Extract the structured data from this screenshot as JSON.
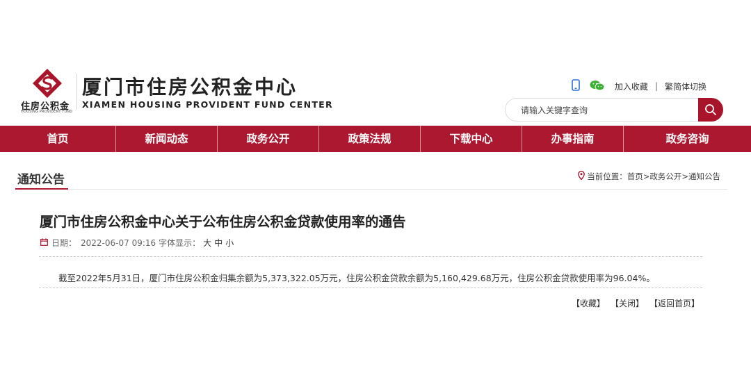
{
  "header": {
    "logo_cn": "住房公积金",
    "logo_en": "HOUSING PROVIDENT FUND",
    "site_title": "厦门市住房公积金中心",
    "site_subtitle": "XIAMEN HOUSING PROVIDENT FUND CENTER",
    "links": {
      "favorite": "加入收藏",
      "separator": "|",
      "lang_switch": "繁简体切换"
    },
    "icons": [
      "mobile-icon",
      "wechat-icon"
    ]
  },
  "search": {
    "placeholder": "请输入关键字查询",
    "icon": "search-icon"
  },
  "nav": {
    "items": [
      "首页",
      "新闻动态",
      "政务公开",
      "政策法规",
      "下载中心",
      "办事指南",
      "政务咨询"
    ]
  },
  "section": {
    "title": "通知公告",
    "breadcrumb_prefix": "当前位置：",
    "crumbs": [
      "首页",
      "政务公开",
      "通知公告"
    ],
    "crumb_sep": ">"
  },
  "article": {
    "title": "厦门市住房公积金中心关于公布住房公积金贷款使用率的通告",
    "date_label": "日期：",
    "date": "2022-06-07 09:16",
    "font_label": "字体显示：",
    "font_options": [
      "大",
      "中",
      "小"
    ],
    "body": "截至2022年5月31日，厦门市住房公积金归集余额为5,373,322.05万元，住房公积金贷款余额为5,160,429.68万元，住房公积金贷款使用率为96.04%。"
  },
  "actions": {
    "collect": "【收藏】",
    "close": "【关闭】",
    "home": "【返回首页】"
  },
  "colors": {
    "brand_red": "#ab1830",
    "search_btn": "#a8152b",
    "wechat_green": "#3cb034"
  }
}
